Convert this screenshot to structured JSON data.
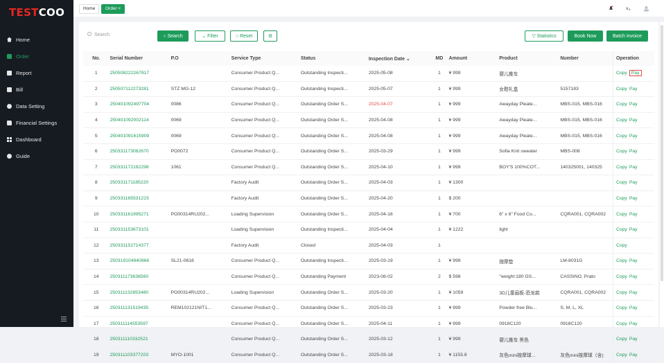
{
  "brand": {
    "logo_a": "TEST",
    "logo_b": "COO"
  },
  "sidebar": {
    "items": [
      {
        "label": "Home",
        "icon": "home-icon"
      },
      {
        "label": "Order",
        "icon": "order-icon",
        "active": true
      },
      {
        "label": "Report",
        "icon": "report-icon"
      },
      {
        "label": "Bill",
        "icon": "bill-icon"
      },
      {
        "label": "Data Setting",
        "icon": "gear-icon"
      },
      {
        "label": "Financial Settings",
        "icon": "folder-icon"
      },
      {
        "label": "Dashboard",
        "icon": "grid-icon"
      },
      {
        "label": "Guide",
        "icon": "info-icon"
      }
    ]
  },
  "tabs": {
    "home": "Home",
    "order": "Order ×"
  },
  "toolbar": {
    "search_placeholder": "Search",
    "search_btn": "○ Search",
    "filter_btn": "⌄ Filter",
    "reset_btn": "○ Reset",
    "statistics_btn": "▽ Statistics",
    "book_now_btn": "Book Now",
    "batch_invoice_btn": "Batch Invoice"
  },
  "table": {
    "headers": [
      "No.",
      "Serial Number",
      "P.O",
      "Service Type",
      "Status",
      "Inspection Date ⌄",
      "MD",
      "Amount",
      "Product",
      "Number",
      "Operation"
    ],
    "rows": [
      [
        "1",
        "250508222267817",
        "",
        "Consumer Product Q...",
        "Outstanding Inspecti...",
        "2025-05-08",
        "1",
        "¥ 999",
        "婴儿推车",
        "",
        "Copy",
        "Pay"
      ],
      [
        "2",
        "250507112273281",
        "STZ MG-12",
        "Consumer Product Q...",
        "Outstanding Inspecti...",
        "2025-05-07",
        "1",
        "¥ 999",
        "女鞋礼盒",
        "5157183",
        "Copy",
        "Pay"
      ],
      [
        "3",
        "250401092497704",
        "0086",
        "Consumer Product Q...",
        "Outstanding Order S...",
        "2025-04-07",
        "1",
        "¥ 999",
        "Awayday Pleate...",
        "MBS-015, MBS-016",
        "Copy",
        "Pay"
      ],
      [
        "4",
        "250401092002114",
        "0069",
        "Consumer Product Q...",
        "Outstanding Order S...",
        "2025-04-08",
        "1",
        "¥ 999",
        "Awayday Pleate...",
        "MBS-015, MBS-016",
        "Copy",
        "Pay"
      ],
      [
        "5",
        "250401091615909",
        "0069",
        "Consumer Product Q...",
        "Outstanding Order S...",
        "2025-04-08",
        "1",
        "¥ 999",
        "Awayday Pleate...",
        "MBS-015, MBS-016",
        "Copy",
        "Pay"
      ],
      [
        "6",
        "250331173082670",
        "PO0072",
        "Consumer Product Q...",
        "Outstanding Order S...",
        "2025-03-29",
        "1",
        "¥ 999",
        "Sofia Knit sweater",
        "MBS-008",
        "Copy",
        "Pay"
      ],
      [
        "7",
        "250331172182298",
        "1061",
        "Consumer Product Q...",
        "Outstanding Order S...",
        "2025-04-10",
        "1",
        "¥ 999",
        "BOY'S 100%COT...",
        "140325001, 140325",
        "Copy",
        "Pay"
      ],
      [
        "8",
        "250331171185220",
        "",
        "Factory Audit",
        "Outstanding Order S...",
        "2025-04-03",
        "1",
        "¥ 1300",
        "",
        "",
        "Copy",
        "Pay"
      ],
      [
        "9",
        "250331165531223",
        "",
        "Factory Audit",
        "Outstanding Order S...",
        "2025-04-20",
        "1",
        "$ 200",
        "",
        "",
        "Copy",
        "Pay"
      ],
      [
        "10",
        "250331161995271",
        "PO00314RU202...",
        "Loading Supervision",
        "Outstanding Order S...",
        "2025-04-16",
        "1",
        "¥ 700",
        "6\" x 6\" Food Co...",
        "CQRA001, CQRA002",
        "Copy",
        "Pay"
      ],
      [
        "11",
        "250331153673101",
        "",
        "Loading Supervision",
        "Outstanding Inspecti...",
        "2025-04-04",
        "1",
        "¥ 1222",
        "light",
        "",
        "Copy",
        "Pay"
      ],
      [
        "12",
        "250331152714377",
        "",
        "Factory Audit",
        "Closed",
        "2025-04-03",
        "1",
        "",
        "",
        "",
        "Copy",
        ""
      ],
      [
        "13",
        "250319104940866",
        "SL21-0618",
        "Consumer Product Q...",
        "Outstanding Inspecti...",
        "2025-03-19",
        "1",
        "¥ 999",
        "按摩垫",
        "LM-8031G",
        "Copy",
        "Pay"
      ],
      [
        "14",
        "250311173636560",
        "",
        "Consumer Product Q...",
        "Outstanding Payment",
        "2023-08-02",
        "2",
        "$ 598",
        "\"weight:180 GS...",
        "CASSINO, Prato",
        "Copy",
        "Pay"
      ],
      [
        "15",
        "250311132853480",
        "PO00314RU202...",
        "Loading Supervision",
        "Outstanding Order S...",
        "2025-03-20",
        "1",
        "¥ 1059",
        "3D儿童画板-恐龙款",
        "CQRA001, CQRA002",
        "Copy",
        "Pay"
      ],
      [
        "16",
        "250311131519435",
        "REM102121NIT1...",
        "Consumer Product Q...",
        "Outstanding Order S...",
        "2025-03-23",
        "1",
        "¥ 999",
        "Powder free Blu...",
        "S, M, L, XL",
        "Copy",
        "Pay"
      ],
      [
        "17",
        "250311114553597",
        "",
        "Consumer Product Q...",
        "Outstanding Order S...",
        "2025-04-11",
        "1",
        "¥ 999",
        "0918C120",
        "0918C120",
        "Copy",
        "Pay"
      ],
      [
        "18",
        "250311110332521",
        "",
        "Consumer Product Q...",
        "Outstanding Order S...",
        "2025-03-12",
        "1",
        "¥ 999",
        "婴儿推车 黑色",
        "",
        "Copy",
        "Pay"
      ],
      [
        "19",
        "250311103377203",
        "MYO-1001",
        "Consumer Product Q...",
        "Outstanding Order S...",
        "2025-03-18",
        "1",
        "¥ 1153.8",
        "灰色mini按摩球...",
        "灰色mini按摩球（含)",
        "Copy",
        "Pay"
      ]
    ],
    "highlight_date_row": 3,
    "highlight_color": "#e54a4a",
    "accent": "#1d9b5a"
  }
}
